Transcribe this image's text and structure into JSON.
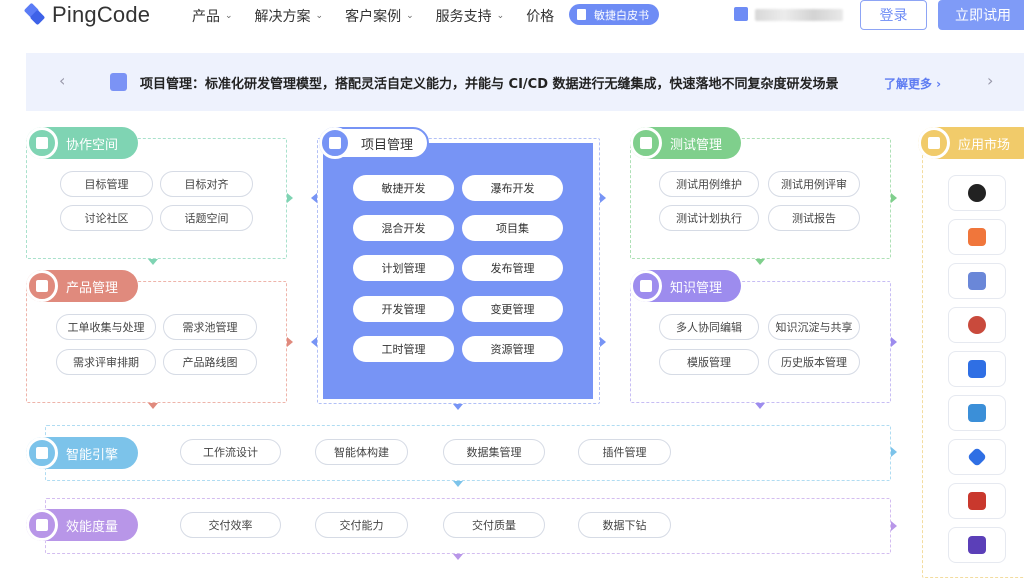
{
  "nav": {
    "logo_text": "PingCode",
    "menu": [
      {
        "label": "产品",
        "has_dropdown": true
      },
      {
        "label": "解决方案",
        "has_dropdown": true
      },
      {
        "label": "客户案例",
        "has_dropdown": true
      },
      {
        "label": "服务支持",
        "has_dropdown": true
      },
      {
        "label": "价格",
        "has_dropdown": false
      }
    ],
    "whitepaper_label": "敏捷白皮书",
    "login_label": "登录",
    "trial_label": "立即试用"
  },
  "banner": {
    "text": "项目管理：标准化研发管理模型，搭配灵活自定义能力，并能与 CI/CD 数据进行无缝集成，快速落地不同复杂度研发场景",
    "more_label": "了解更多 ›",
    "prev_arrow": "‹",
    "next_arrow": "›"
  },
  "colors": {
    "collab": "#7fd4b3",
    "product": "#e08a7d",
    "project": "#7794f5",
    "test": "#7fcf8c",
    "knowledge": "#9d8cee",
    "smart": "#7cc3ea",
    "efficiency": "#b896e8",
    "market": "#f1cb6a"
  },
  "modules": {
    "collab": {
      "title": "协作空间",
      "items": [
        "目标管理",
        "目标对齐",
        "讨论社区",
        "话题空间"
      ]
    },
    "product": {
      "title": "产品管理",
      "items": [
        "工单收集与处理",
        "需求池管理",
        "需求评审排期",
        "产品路线图"
      ]
    },
    "project": {
      "title": "项目管理",
      "items": [
        "敏捷开发",
        "瀑布开发",
        "混合开发",
        "项目集",
        "计划管理",
        "发布管理",
        "开发管理",
        "变更管理",
        "工时管理",
        "资源管理"
      ]
    },
    "test": {
      "title": "测试管理",
      "items": [
        "测试用例维护",
        "测试用例评审",
        "测试计划执行",
        "测试报告"
      ]
    },
    "knowledge": {
      "title": "知识管理",
      "items": [
        "多人协同编辑",
        "知识沉淀与共享",
        "模版管理",
        "历史版本管理"
      ]
    },
    "smart": {
      "title": "智能引擎",
      "items": [
        "工作流设计",
        "智能体构建",
        "数据集管理",
        "插件管理"
      ]
    },
    "efficiency": {
      "title": "效能度量",
      "items": [
        "交付效率",
        "交付能力",
        "交付质量",
        "数据下钻"
      ]
    },
    "market": {
      "title": "应用市场",
      "apps": [
        "github-icon",
        "gitlab-icon",
        "jenkins-like-icon",
        "jenkins-icon",
        "bitbucket-icon",
        "vscode-icon",
        "jira-icon",
        "gitee-icon",
        "kubernetes-icon"
      ]
    }
  }
}
